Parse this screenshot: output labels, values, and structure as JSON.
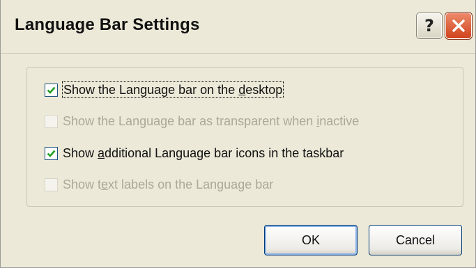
{
  "window": {
    "title": "Language Bar Settings",
    "help_label": "?"
  },
  "options": [
    {
      "pre": "Show the Language bar on the ",
      "key": "d",
      "post": "esktop",
      "checked": true,
      "enabled": true
    },
    {
      "pre": "Show the Language bar as transparent when ",
      "key": "i",
      "post": "nactive",
      "checked": false,
      "enabled": false
    },
    {
      "pre": "Show ",
      "key": "a",
      "post": "dditional Language bar icons in the taskbar",
      "checked": true,
      "enabled": true
    },
    {
      "pre": "Show t",
      "key": "e",
      "post": "xt labels on the Language bar",
      "checked": false,
      "enabled": false
    }
  ],
  "buttons": {
    "ok_label": "OK",
    "cancel_label": "Cancel"
  },
  "colors": {
    "dialog_bg": "#ece9d8",
    "check_mark": "#21a121",
    "close_red": "#d0441d",
    "button_border": "#003c74"
  }
}
